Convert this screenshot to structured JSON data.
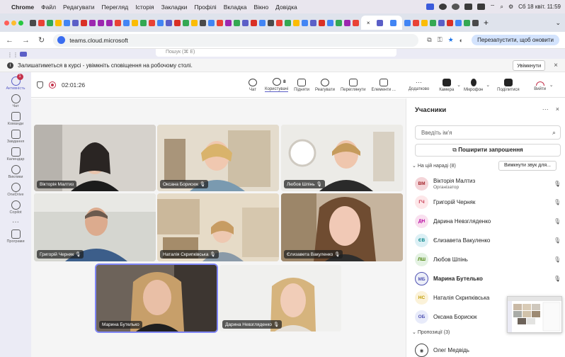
{
  "menubar": {
    "app": "Chrome",
    "items": [
      "Файл",
      "Редагувати",
      "Перегляд",
      "Історія",
      "Закладки",
      "Профілі",
      "Вкладка",
      "Вікно",
      "Довідка"
    ],
    "clock": "Сб 18 квіт. 11:59"
  },
  "browser": {
    "url": "teams.cloud.microsoft",
    "restart_label": "Перезапустити, щоб оновити",
    "tab_add": "+"
  },
  "teams": {
    "search_placeholder": "Пошук (⌘ E)"
  },
  "banner": {
    "text": "Залишатиметься в курсі - увімкніть сповіщення на робочому столі.",
    "button": "Увімкнути"
  },
  "rail": {
    "items": [
      {
        "label": "Активність",
        "badge": "1"
      },
      {
        "label": "Чат"
      },
      {
        "label": "Команди"
      },
      {
        "label": "Завдання"
      },
      {
        "label": "Календар"
      },
      {
        "label": "Виклики"
      },
      {
        "label": "OneDrive"
      },
      {
        "label": "Copilot"
      },
      {
        "label": "Програми"
      }
    ],
    "more": "···"
  },
  "meeting": {
    "timer": "02:01:26",
    "participant_count": "8",
    "toolbar": [
      {
        "label": "Чат",
        "icon": "chat-icon"
      },
      {
        "label": "Користувачі",
        "icon": "people-icon"
      },
      {
        "label": "Підняти",
        "icon": "raise-hand-icon"
      },
      {
        "label": "Реагувати",
        "icon": "reaction-icon"
      },
      {
        "label": "Переглянути",
        "icon": "view-icon"
      },
      {
        "label": "Елементи ...",
        "icon": "apps-icon"
      },
      {
        "label": "Додатково",
        "icon": "more-icon"
      },
      {
        "label": "Камера",
        "icon": "camera-icon"
      },
      {
        "label": "Мікрофон",
        "icon": "mic-icon"
      },
      {
        "label": "Поділитися",
        "icon": "share-icon"
      },
      {
        "label": "Вийти",
        "icon": "leave-icon"
      }
    ]
  },
  "tiles": [
    {
      "name": "Вікторія Малтиз",
      "muted": false
    },
    {
      "name": "Оксана Борисюк",
      "muted": true
    },
    {
      "name": "Любов Шпінь",
      "muted": true
    },
    {
      "name": "Григорій Черняк",
      "muted": true
    },
    {
      "name": "Наталія Скрипківська",
      "muted": true
    },
    {
      "name": "Єлизавета Вакуленко",
      "muted": true
    },
    {
      "name": "Марина Бутелько",
      "muted": false
    },
    {
      "name": "Дарина Невзгляденко",
      "muted": true
    }
  ],
  "panel": {
    "title": "Учасники",
    "search_placeholder": "Введіть ім'я",
    "share_label": "Поширити запрошення",
    "in_meeting_label": "На цій нараді (8)",
    "mute_all_label": "Вимкнути звук для...",
    "suggestions_label": "Пропозиції (3)",
    "participants": [
      {
        "initials": "ВМ",
        "name": "Вікторія Малтиз",
        "role": "Організатор",
        "mic": "on",
        "bg": "#f4d5d9",
        "fg": "#a4262c"
      },
      {
        "initials": "ГЧ",
        "name": "Григорій Черняк",
        "mic": "off",
        "bg": "#fde7e9",
        "fg": "#c4314b"
      },
      {
        "initials": "ДН",
        "name": "Дарина Невзгляденко",
        "mic": "off",
        "bg": "#f9e0ef",
        "fg": "#b4009e"
      },
      {
        "initials": "ЄВ",
        "name": "Єлизавета Вакуленко",
        "mic": "off",
        "bg": "#dcf0f5",
        "fg": "#038387"
      },
      {
        "initials": "ЛШ",
        "name": "Любов Шпінь",
        "mic": "off",
        "bg": "#e4f2e3",
        "fg": "#498205"
      },
      {
        "initials": "МБ",
        "name": "Марина Бутелько",
        "mic": "on",
        "bg": "#eceff8",
        "fg": "#4f52b2",
        "bold": true
      },
      {
        "initials": "НС",
        "name": "Наталія Скрипківська",
        "mic": "off",
        "bg": "#fbf2d9",
        "fg": "#c19c00"
      },
      {
        "initials": "ОБ",
        "name": "Оксана Борисюк",
        "mic": "off",
        "bg": "#e8ebfa",
        "fg": "#4f52b2"
      }
    ],
    "suggested": [
      {
        "name": "Олег Медвідь"
      }
    ]
  }
}
